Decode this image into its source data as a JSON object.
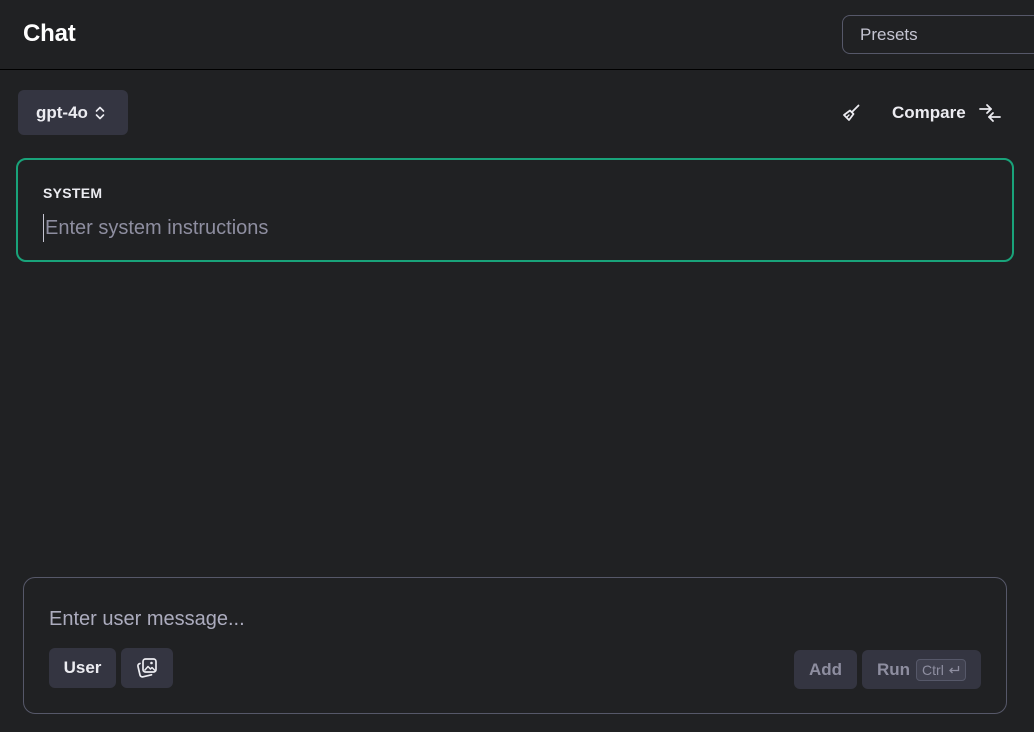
{
  "header": {
    "title": "Chat",
    "presets_placeholder": "Presets"
  },
  "toolbar": {
    "model": "gpt-4o",
    "model_icon": "chevron-up-down-icon",
    "clear_icon": "broom-icon",
    "compare_label": "Compare",
    "compare_icon": "arrows-compare-icon"
  },
  "system": {
    "label": "SYSTEM",
    "placeholder": "Enter system instructions",
    "value": ""
  },
  "composer": {
    "placeholder": "Enter user message...",
    "value": "",
    "role_label": "User",
    "attach_icon": "image-gallery-icon",
    "add_label": "Add",
    "run_label": "Run",
    "shortcut_key": "Ctrl",
    "shortcut_icon": "enter-key-icon"
  },
  "colors": {
    "background": "#202123",
    "surface": "#343541",
    "accent": "#19a37a",
    "border": "#565869"
  }
}
